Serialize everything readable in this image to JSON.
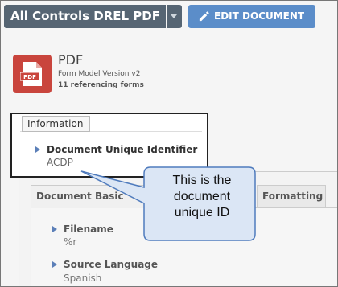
{
  "toolbar": {
    "document_title": "All Controls DREL PDF",
    "edit_label": "EDIT DOCUMENT"
  },
  "header": {
    "icon_text": "PDF",
    "title": "PDF",
    "model_version": "Form Model Version v2",
    "referencing_forms": "11 referencing forms"
  },
  "information": {
    "tab_label": "Information",
    "field_label": "Document Unique Identifier",
    "field_value": "ACDP"
  },
  "tabs": {
    "basic": "Document Basic",
    "formatting": "Formatting"
  },
  "fields": [
    {
      "label": "Filename",
      "value": "%r"
    },
    {
      "label": "Source Language",
      "value": "Spanish"
    }
  ],
  "callout": {
    "lines": [
      "This is the",
      "document",
      "unique ID"
    ]
  },
  "colors": {
    "title_button": "#566573",
    "edit_button": "#5b8dc9",
    "pdf_icon": "#c9453d",
    "callout_fill": "#dbe6f5",
    "callout_border": "#4f7bbd"
  }
}
